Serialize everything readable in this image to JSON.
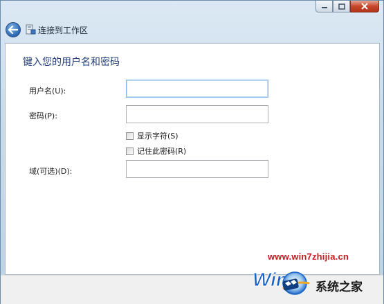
{
  "window": {
    "title": "连接到工作区",
    "caption_buttons": [
      "minimize",
      "maximize",
      "close"
    ]
  },
  "form": {
    "heading": "键入您的用户名和密码",
    "username_label": "用户名(U):",
    "username_value": "",
    "password_label": "密码(P):",
    "password_value": "",
    "show_chars_label": "显示字符(S)",
    "show_chars_checked": false,
    "remember_label": "记住此密码(R)",
    "remember_checked": false,
    "domain_label": "域(可选)(D):",
    "domain_value": ""
  },
  "watermark": {
    "url": "www.win7zhijia.cn",
    "logo_text": "Win7",
    "brand_text": "系统之家"
  },
  "icons": {
    "back": "back-arrow-icon",
    "title": "workplace-connection-icon",
    "minimize": "minimize-icon",
    "maximize": "maximize-icon",
    "close": "close-icon"
  },
  "colors": {
    "heading": "#1e3a78",
    "close_button": "#c7472b",
    "watermark_url": "#c9161d",
    "logo_blue": "#1a63c4"
  }
}
